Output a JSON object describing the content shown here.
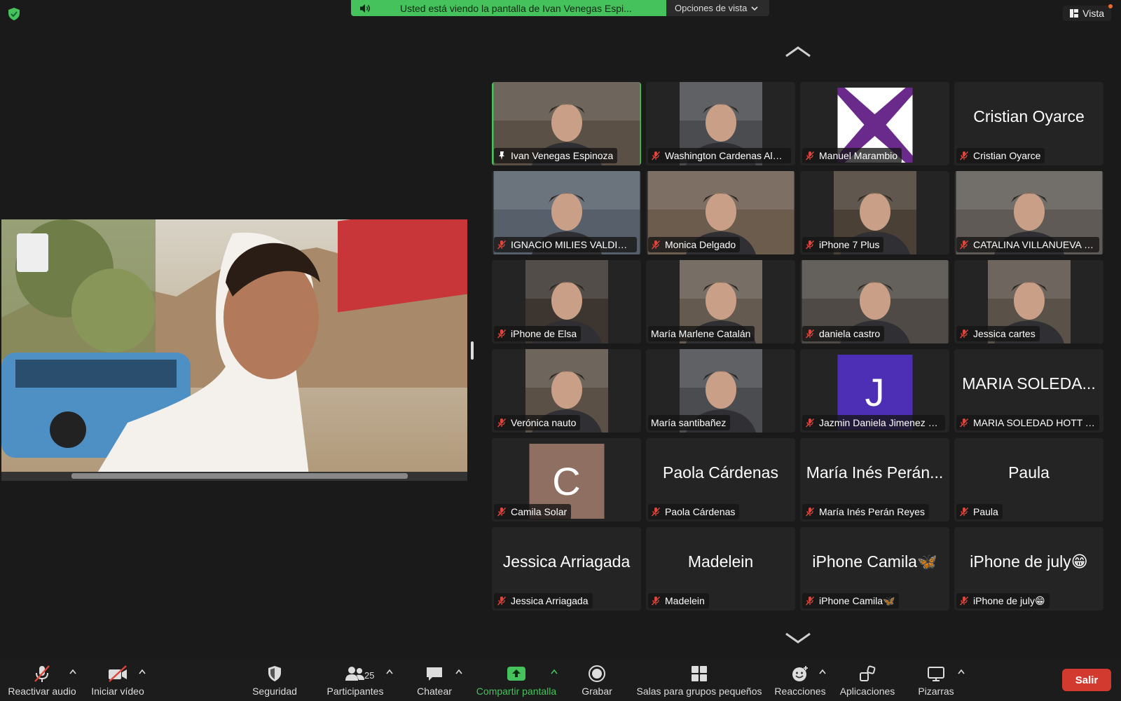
{
  "banner": {
    "text": "Usted está viendo la pantalla de Ivan Venegas Espi...",
    "view_options": "Opciones de vista",
    "view": "Vista"
  },
  "colors": {
    "accent": "#46c25c",
    "exit": "#d33a2f",
    "tile_bg": "#242424",
    "muted_mic": "#e0453a"
  },
  "tiles": [
    {
      "name": "Ivan Venegas Espinoza",
      "kind": "video",
      "active": true,
      "mic": "pin"
    },
    {
      "name": "Washington Cardenas Alm...",
      "kind": "video",
      "mic": "muted"
    },
    {
      "name": "Manuel Marambio",
      "kind": "logo",
      "mic": "muted"
    },
    {
      "name": "Cristian Oyarce",
      "kind": "name",
      "big": "Cristian Oyarce",
      "mic": "muted"
    },
    {
      "name": "IGNACIO MILIES VALDIVIA",
      "kind": "video",
      "mic": "muted"
    },
    {
      "name": "Monica Delgado",
      "kind": "video",
      "mic": "muted"
    },
    {
      "name": "iPhone 7 Plus",
      "kind": "video",
      "mic": "muted"
    },
    {
      "name": "CATALINA VILLANUEVA DE...",
      "kind": "video",
      "mic": "muted"
    },
    {
      "name": "iPhone de Elsa",
      "kind": "video",
      "mic": "muted"
    },
    {
      "name": "María Marlene Catalán",
      "kind": "video",
      "mic": "none"
    },
    {
      "name": "daniela castro",
      "kind": "video",
      "mic": "muted"
    },
    {
      "name": "Jessica cartes",
      "kind": "video",
      "mic": "muted"
    },
    {
      "name": "Verónica nauto",
      "kind": "video",
      "mic": "muted"
    },
    {
      "name": "María santibañez",
      "kind": "video",
      "mic": "none"
    },
    {
      "name": "Jazmin Daniela Jimenez Sa...",
      "kind": "avatar",
      "initial": "J",
      "mic": "muted"
    },
    {
      "name": "MARIA SOLEDAD HOTT TO...",
      "kind": "name",
      "big": "MARIA SOLEDA...",
      "mic": "muted"
    },
    {
      "name": "Camila Solar",
      "kind": "avatar",
      "initial": "C",
      "mic": "muted"
    },
    {
      "name": "Paola Cárdenas",
      "kind": "name",
      "big": "Paola Cárdenas",
      "mic": "muted"
    },
    {
      "name": "María Inés Perán Reyes",
      "kind": "name",
      "big": "María Inés Perán...",
      "mic": "muted"
    },
    {
      "name": "Paula",
      "kind": "name",
      "big": "Paula",
      "mic": "muted"
    },
    {
      "name": "Jessica Arriagada",
      "kind": "name",
      "big": "Jessica Arriagada",
      "mic": "muted"
    },
    {
      "name": "Madelein",
      "kind": "name",
      "big": "Madelein",
      "mic": "muted"
    },
    {
      "name": "iPhone Camila🦋",
      "kind": "name",
      "big": "iPhone Camila🦋",
      "mic": "muted"
    },
    {
      "name": "iPhone de july😁",
      "kind": "name",
      "big": "iPhone de july😁",
      "mic": "muted"
    }
  ],
  "toolbar": {
    "audio": "Reactivar audio",
    "video": "Iniciar vídeo",
    "security": "Seguridad",
    "participants": "Participantes",
    "participants_count": "25",
    "chat": "Chatear",
    "share": "Compartir pantalla",
    "record": "Grabar",
    "breakout": "Salas para grupos pequeños",
    "reactions": "Reacciones",
    "apps": "Aplicaciones",
    "whiteboards": "Pizarras",
    "exit": "Salir"
  }
}
